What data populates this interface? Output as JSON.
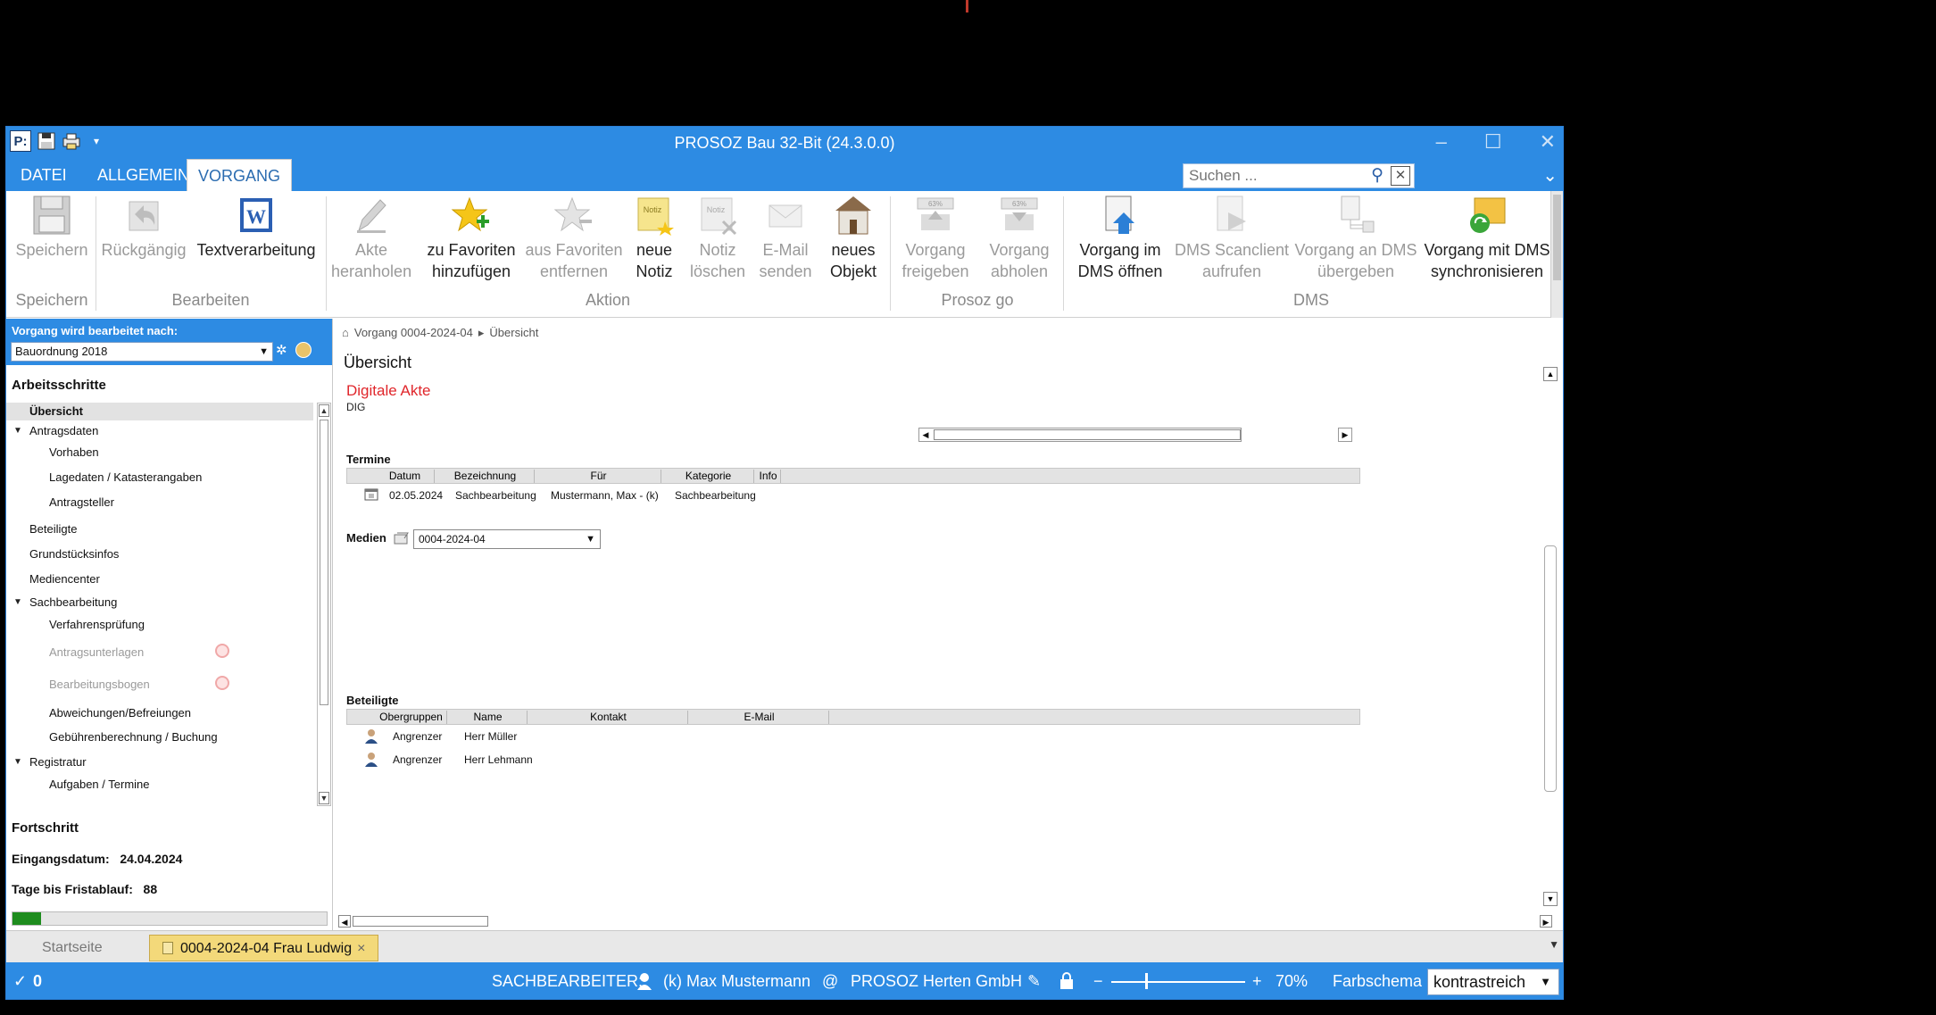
{
  "window": {
    "title": "PROSOZ Bau 32-Bit (24.3.0.0)"
  },
  "qat": {
    "app_label": "P:"
  },
  "tabs": [
    {
      "label": "DATEI"
    },
    {
      "label": "ALLGEMEIN"
    },
    {
      "label": "VORGANG"
    }
  ],
  "search": {
    "placeholder": "Suchen ..."
  },
  "ribbon": {
    "buttons": {
      "speichern": "Speichern",
      "rueckgaengig": "Rückgängig",
      "textverarbeitung": "Textverarbeitung",
      "akte_heranholen_1": "Akte",
      "akte_heranholen_2": "heranholen",
      "zu_favoriten_1": "zu Favoriten",
      "zu_favoriten_2": "hinzufügen",
      "aus_favoriten_1": "aus Favoriten",
      "aus_favoriten_2": "entfernen",
      "neue_notiz_1": "neue",
      "neue_notiz_2": "Notiz",
      "notiz_loeschen_1": "Notiz",
      "notiz_loeschen_2": "löschen",
      "email_senden_1": "E-Mail",
      "email_senden_2": "senden",
      "neues_objekt_1": "neues",
      "neues_objekt_2": "Objekt",
      "vorgang_freigeben_1": "Vorgang",
      "vorgang_freigeben_2": "freigeben",
      "vorgang_abholen_1": "Vorgang",
      "vorgang_abholen_2": "abholen",
      "dms_oeffnen_1": "Vorgang im",
      "dms_oeffnen_2": "DMS öffnen",
      "dms_scanclient_1": "DMS Scanclient",
      "dms_scanclient_2": "aufrufen",
      "dms_uebergeben_1": "Vorgang an DMS",
      "dms_uebergeben_2": "übergeben",
      "dms_sync_1": "Vorgang mit DMS",
      "dms_sync_2": "synchronisieren"
    },
    "groups": {
      "speichern": "Speichern",
      "bearbeiten": "Bearbeiten",
      "aktion": "Aktion",
      "prosoz_go": "Prosoz go",
      "dms": "DMS"
    }
  },
  "left": {
    "header_label": "Vorgang wird bearbeitet nach:",
    "ordnung": "Bauordnung 2018",
    "arbeitsschritte": "Arbeitsschritte",
    "items": {
      "uebersicht": "Übersicht",
      "antragsdaten": "Antragsdaten",
      "vorhaben": "Vorhaben",
      "lagedaten": "Lagedaten / Katasterangaben",
      "antragsteller": "Antragsteller",
      "beteiligte": "Beteiligte",
      "grundstuecksinfos": "Grundstücksinfos",
      "mediencenter": "Mediencenter",
      "sachbearbeitung": "Sachbearbeitung",
      "verfahrenspruefung": "Verfahrensprüfung",
      "antragsunterlagen": "Antragsunterlagen",
      "bearbeitungsbogen": "Bearbeitungsbogen",
      "abweichungen": "Abweichungen/Befreiungen",
      "gebuehren": "Gebührenberechnung / Buchung",
      "registratur": "Registratur",
      "aufgaben": "Aufgaben / Termine"
    },
    "fortschritt": "Fortschritt",
    "eingangsdatum_label": "Eingangsdatum:",
    "eingangsdatum": "24.04.2024",
    "tage_label": "Tage bis Fristablauf:",
    "tage": "88",
    "progress_fraction": 0.09
  },
  "main": {
    "breadcrumb": {
      "vorgang": "Vorgang 0004-2024-04",
      "page": "Übersicht"
    },
    "title": "Übersicht",
    "akte_title": "Digitale Akte",
    "akte_sub": "DIG",
    "termine": {
      "label": "Termine",
      "columns": [
        "Datum",
        "Bezeichnung",
        "Für",
        "Kategorie",
        "Info"
      ],
      "rows": [
        {
          "datum": "02.05.2024",
          "bezeichnung": "Sachbearbeitung",
          "fuer": "Mustermann, Max - (k)",
          "kategorie": "Sachbearbeitung"
        }
      ]
    },
    "medien": {
      "label": "Medien",
      "value": "0004-2024-04"
    },
    "beteiligte": {
      "label": "Beteiligte",
      "columns": [
        "Obergruppen",
        "Name",
        "Kontakt",
        "E-Mail"
      ],
      "rows": [
        {
          "gruppe": "Angrenzer",
          "name": "Herr Müller"
        },
        {
          "gruppe": "Angrenzer",
          "name": "Herr Lehmann"
        }
      ]
    }
  },
  "doctabs": {
    "startseite": "Startseite",
    "vorgang": "0004-2024-04 Frau  Ludwig"
  },
  "status": {
    "count": "0",
    "sachbearbeiter_label": "SACHBEARBEITER:",
    "user": "(k) Max Mustermann",
    "at": "@",
    "org": "PROSOZ Herten GmbH",
    "zoom": "70%",
    "farbschema_label": "Farbschema",
    "farbschema": "kontrastreich"
  },
  "colors": {
    "accent": "#2d8be3",
    "red": "#e0262b",
    "progress": "#1e8c1e"
  }
}
